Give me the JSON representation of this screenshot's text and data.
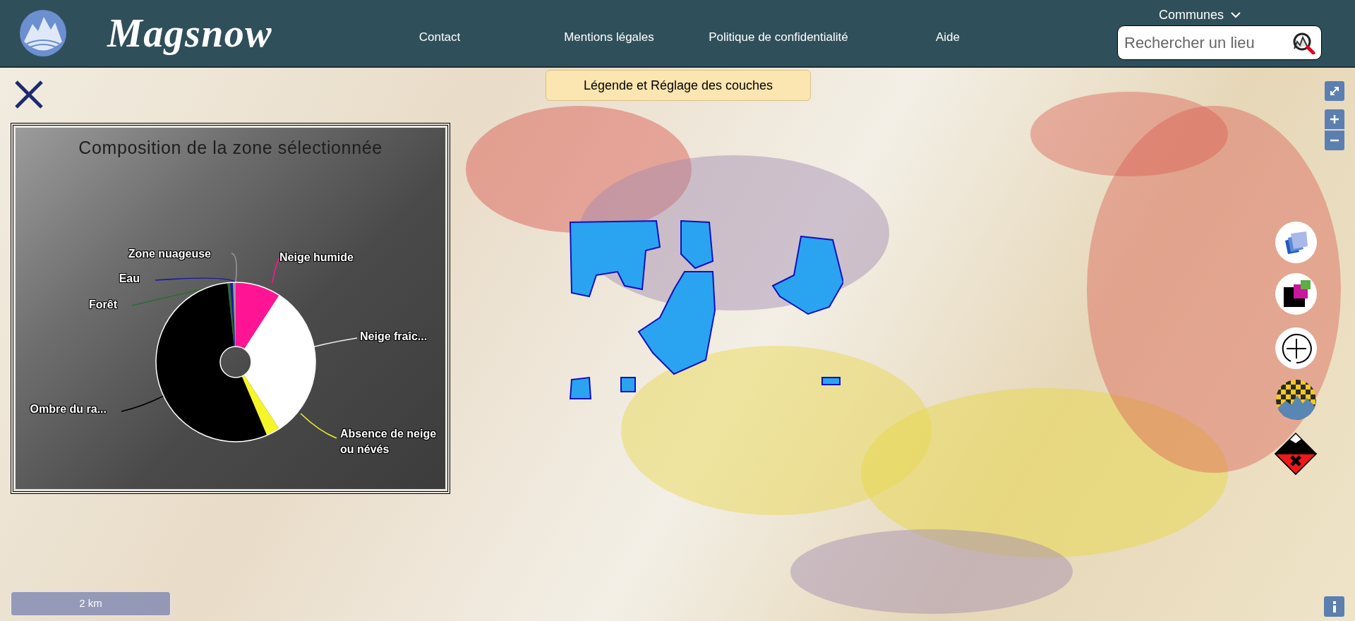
{
  "header": {
    "logo_text": "Magsnow",
    "nav": [
      "Contact",
      "Mentions légales",
      "Politique de confidentialité",
      "Aide"
    ],
    "communes": "Communes",
    "search": {
      "placeholder": "Rechercher un lieu"
    }
  },
  "map": {
    "legend_button": "Légende et Réglage des couches",
    "scale": "2 km"
  },
  "chart_panel": {
    "title": "Composition de la zone sélectionnée",
    "slices": [
      {
        "label": "Neige humide",
        "color": "#ff1493"
      },
      {
        "label": "Neige fraîc...",
        "color": "#ffffff"
      },
      {
        "label": "Absence de neige ou névés",
        "color": "#f5f52a"
      },
      {
        "label": "Ombre du ra...",
        "color": "#000000"
      },
      {
        "label": "Forêt",
        "color": "#2e6b2e"
      },
      {
        "label": "Eau",
        "color": "#1a1aa0"
      },
      {
        "label": "Zone nuageuse",
        "color": "#9a9a9a"
      }
    ]
  }
}
